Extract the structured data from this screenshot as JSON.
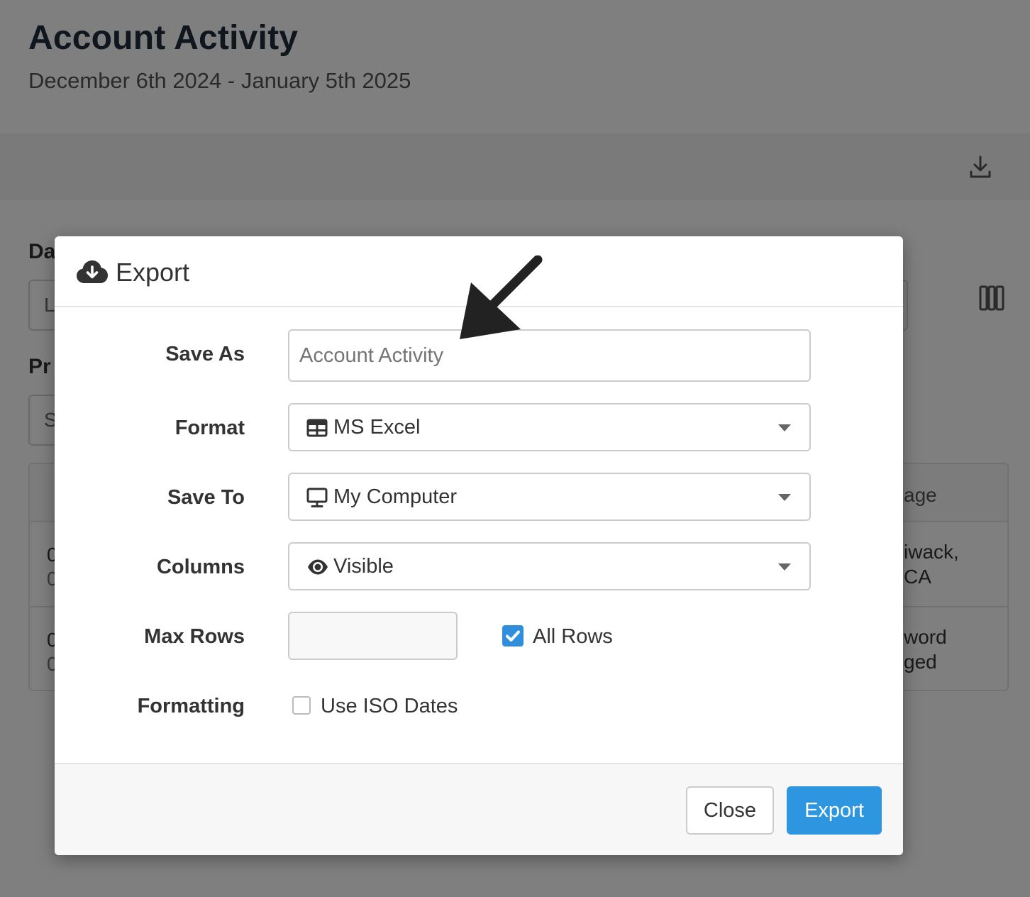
{
  "page": {
    "title": "Account Activity",
    "subtitle": "December 6th 2024 - January 5th 2025",
    "filter_label_1": "Da",
    "filter_value_1": "L",
    "filter_label_2": "Pr",
    "filter_value_2": "S",
    "table": {
      "header_tail": "age",
      "row1_col1_line1": "0",
      "row1_col1_line2": "0",
      "row1_tail": "iwack,\nCA",
      "row2_col1_line1": "0",
      "row2_col1_line2": "0",
      "row2_tail": "word\nged"
    }
  },
  "modal": {
    "title": "Export",
    "fields": {
      "save_as": {
        "label": "Save As",
        "placeholder": "Account Activity"
      },
      "format": {
        "label": "Format",
        "value": "MS Excel",
        "icon": "table-icon"
      },
      "save_to": {
        "label": "Save To",
        "value": "My Computer",
        "icon": "desktop-icon"
      },
      "columns": {
        "label": "Columns",
        "value": "Visible",
        "icon": "eye-icon"
      },
      "max_rows": {
        "label": "Max Rows",
        "value": "",
        "all_rows_label": "All Rows",
        "all_rows_checked": true
      },
      "formatting": {
        "label": "Formatting",
        "iso_dates_label": "Use ISO Dates",
        "iso_dates_checked": false
      }
    },
    "buttons": {
      "close": "Close",
      "export": "Export"
    }
  },
  "colors": {
    "primary": "#2e95e0",
    "checkbox": "#2f8fdd",
    "title": "#1f2d3d"
  }
}
